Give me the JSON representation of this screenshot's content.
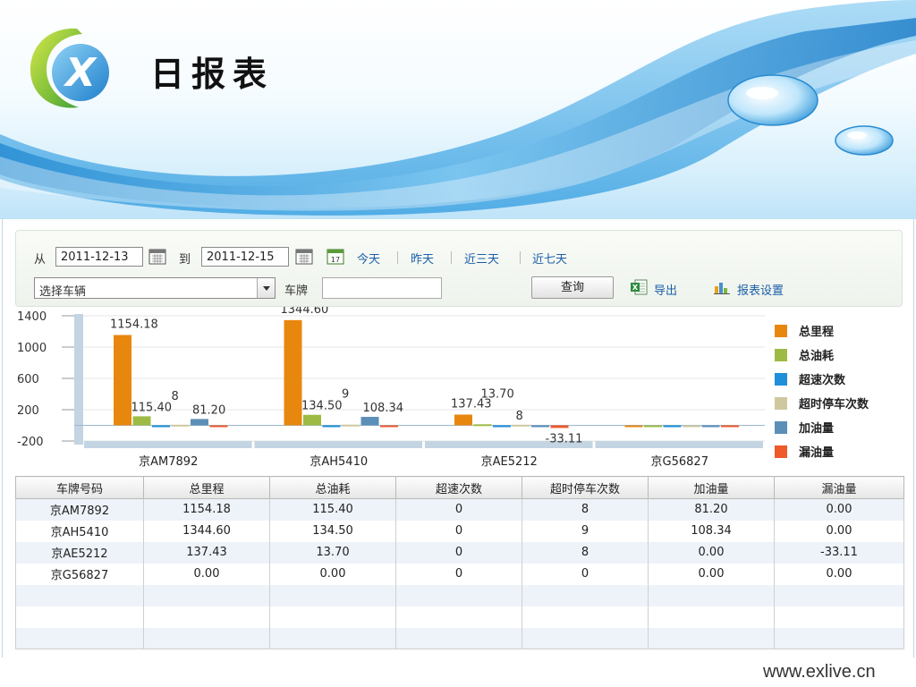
{
  "header": {
    "title": "日报表",
    "footer_url": "www.exlive.cn"
  },
  "toolbar": {
    "from_label": "从",
    "from_date": "2011-12-13",
    "to_label": "到",
    "to_date": "2011-12-15",
    "quick_ranges": [
      "今天",
      "昨天",
      "近三天",
      "近七天"
    ],
    "vehicle_select": "选择车辆",
    "plate_label": "车牌",
    "plate_value": "",
    "query_label": "查询",
    "export_label": "导出",
    "settings_label": "报表设置"
  },
  "chart_data": {
    "type": "bar",
    "categories": [
      "京AM7892",
      "京AH5410",
      "京AE5212",
      "京G56827"
    ],
    "series": [
      {
        "name": "总里程",
        "color": "#e8870e",
        "values": [
          1154.18,
          1344.6,
          137.43,
          0.0
        ],
        "labels": [
          "1154.18",
          "1344.60",
          "137.43",
          ""
        ]
      },
      {
        "name": "总油耗",
        "color": "#9dbb44",
        "values": [
          115.4,
          134.5,
          13.7,
          0.0
        ],
        "labels": [
          "115.40",
          "134.50",
          "13.70",
          ""
        ]
      },
      {
        "name": "超速次数",
        "color": "#1e8fd8",
        "values": [
          0,
          0,
          0,
          0
        ],
        "labels": [
          "",
          "",
          "",
          ""
        ]
      },
      {
        "name": "超时停车次数",
        "color": "#cfc89e",
        "values": [
          8,
          9,
          8,
          0
        ],
        "labels": [
          "8",
          "9",
          "8",
          ""
        ]
      },
      {
        "name": "加油量",
        "color": "#5b8fb8",
        "values": [
          81.2,
          108.34,
          0.0,
          0.0
        ],
        "labels": [
          "81.20",
          "108.34",
          "",
          ""
        ]
      },
      {
        "name": "漏油量",
        "color": "#ee5a2a",
        "values": [
          0.0,
          0.0,
          -33.11,
          0.0
        ],
        "labels": [
          "",
          "",
          "-33.11",
          ""
        ]
      }
    ],
    "yticks": [
      1400,
      1000,
      600,
      200,
      -200
    ],
    "ylim": [
      -200,
      1400
    ],
    "legend_position": "right",
    "grid": true
  },
  "table": {
    "headers": [
      "车牌号码",
      "总里程",
      "总油耗",
      "超速次数",
      "超时停车次数",
      "加油量",
      "漏油量"
    ],
    "rows": [
      [
        "京AM7892",
        "1154.18",
        "115.40",
        "0",
        "8",
        "81.20",
        "0.00"
      ],
      [
        "京AH5410",
        "1344.60",
        "134.50",
        "0",
        "9",
        "108.34",
        "0.00"
      ],
      [
        "京AE5212",
        "137.43",
        "13.70",
        "0",
        "8",
        "0.00",
        "-33.11"
      ],
      [
        "京G56827",
        "0.00",
        "0.00",
        "0",
        "0",
        "0.00",
        "0.00"
      ],
      [
        "",
        "",
        "",
        "",
        "",
        "",
        ""
      ],
      [
        "",
        "",
        "",
        "",
        "",
        "",
        ""
      ],
      [
        "",
        "",
        "",
        "",
        "",
        "",
        ""
      ]
    ]
  }
}
